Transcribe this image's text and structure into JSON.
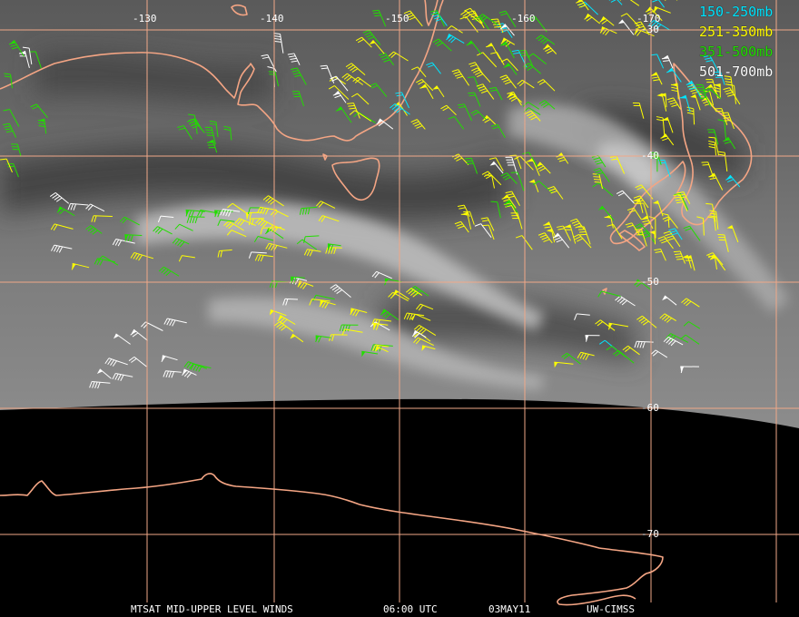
{
  "map": {
    "lon_labels": [
      "-130",
      "-140",
      "-150",
      "-160",
      "-170"
    ],
    "lat_labels": [
      "-30",
      "-40",
      "-50",
      "-60",
      "-70"
    ],
    "gridline_color": "#f0a888",
    "coastline_color": "#f4a584"
  },
  "legend": [
    {
      "label": "150-250mb",
      "color": "#00e5ff"
    },
    {
      "label": "251-350mb",
      "color": "#ffff00"
    },
    {
      "label": "351-500mb",
      "color": "#22dd00"
    },
    {
      "label": "501-700mb",
      "color": "#ffffff"
    }
  ],
  "footer": {
    "title": "MTSAT MID-UPPER LEVEL WINDS",
    "time": "06:00 UTC",
    "date": "03MAY11",
    "source": "UW-CIMSS"
  }
}
